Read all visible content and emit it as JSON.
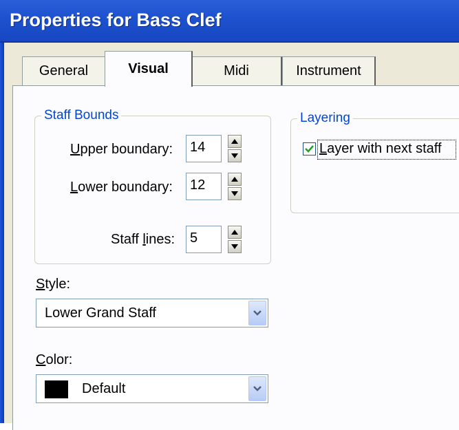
{
  "window": {
    "title": "Properties for Bass Clef"
  },
  "tabs": [
    {
      "label": "General",
      "active": false
    },
    {
      "label": "Visual",
      "active": true
    },
    {
      "label": "Midi",
      "active": false
    },
    {
      "label": "Instrument",
      "active": false
    }
  ],
  "staff_bounds": {
    "title": "Staff Bounds",
    "upper": {
      "label_key": "U",
      "label_rest": "pper boundary:",
      "value": "14"
    },
    "lower": {
      "label_key": "L",
      "label_rest": "ower boundary:",
      "value": "12"
    },
    "lines": {
      "label_pre": "Staff ",
      "label_key": "l",
      "label_rest": "ines:",
      "value": "5"
    }
  },
  "layering": {
    "title": "Layering",
    "checkbox": {
      "label_key": "L",
      "label_rest": "ayer with next staff",
      "checked": true
    }
  },
  "style": {
    "label_key": "S",
    "label_rest": "tyle:",
    "value": "Lower Grand Staff"
  },
  "color": {
    "label_key": "C",
    "label_rest": "olor:",
    "value": "Default",
    "swatch": "#000000"
  },
  "colors": {
    "title_bar": "#1f55d6",
    "dialog_bg": "#ece9d8",
    "group_title": "#0046d5",
    "check": "#21a121"
  }
}
